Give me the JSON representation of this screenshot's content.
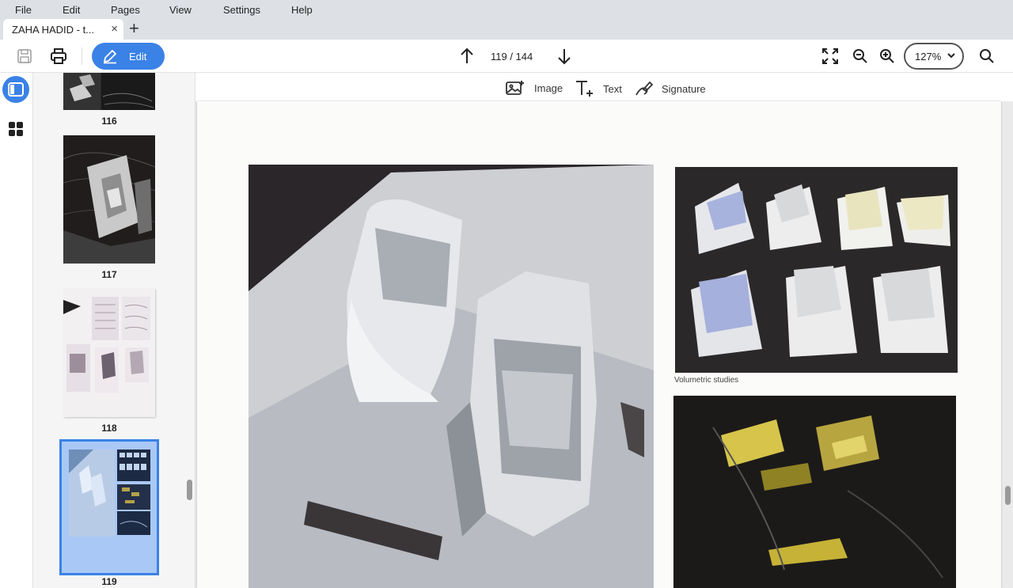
{
  "menu": {
    "file": "File",
    "edit": "Edit",
    "pages": "Pages",
    "view": "View",
    "settings": "Settings",
    "help": "Help"
  },
  "tab": {
    "title": "ZAHA HADID - t...",
    "close_glyph": "×",
    "new_tab_glyph": "+"
  },
  "toolbar": {
    "edit_label": "Edit",
    "page_indicator": "119 / 144",
    "zoom_value": "127%",
    "icons": [
      "save-icon",
      "print-icon",
      "pencil-icon",
      "arrow-up-icon",
      "arrow-down-icon",
      "fit-screen-icon",
      "zoom-out-icon",
      "zoom-in-icon",
      "search-icon"
    ]
  },
  "annotation_bar": {
    "image_label": "Image",
    "text_label": "Text",
    "signature_label": "Signature"
  },
  "thumbnails": [
    {
      "page": "116"
    },
    {
      "page": "117"
    },
    {
      "page": "118"
    },
    {
      "page": "119",
      "selected": true
    }
  ],
  "document": {
    "caption": "Volumetric studies"
  },
  "colors": {
    "accent": "#3b82e6",
    "chrome": "#dde1e6",
    "selection": "#a9c8f5"
  }
}
